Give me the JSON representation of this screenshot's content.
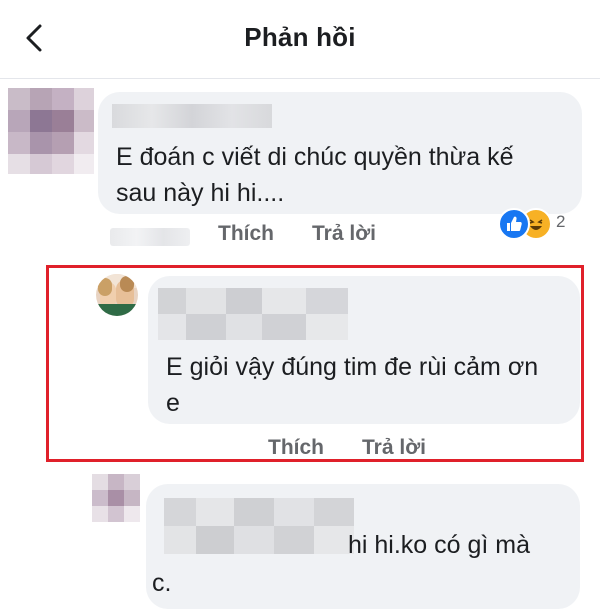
{
  "header": {
    "title": "Phản hồi"
  },
  "comments": [
    {
      "text_line1": "E đoán c viết di chúc  quyền thừa kế",
      "text_line2": "sau này hi hi....",
      "like_label": "Thích",
      "reply_label": "Trả lời",
      "reaction_count": "2"
    },
    {
      "text_line1": "E giỏi vậy đúng tim đe rùi cảm ơn",
      "text_line2": "e",
      "like_label": "Thích",
      "reply_label": "Trả lời"
    },
    {
      "text_line1": "hi hi.ko có gì mà",
      "text_line2": "c."
    }
  ],
  "colors": {
    "bubble": "#f0f2f5",
    "highlight": "#e0202a",
    "action": "#65676b",
    "like": "#1877f2",
    "haha": "#f7b125"
  }
}
